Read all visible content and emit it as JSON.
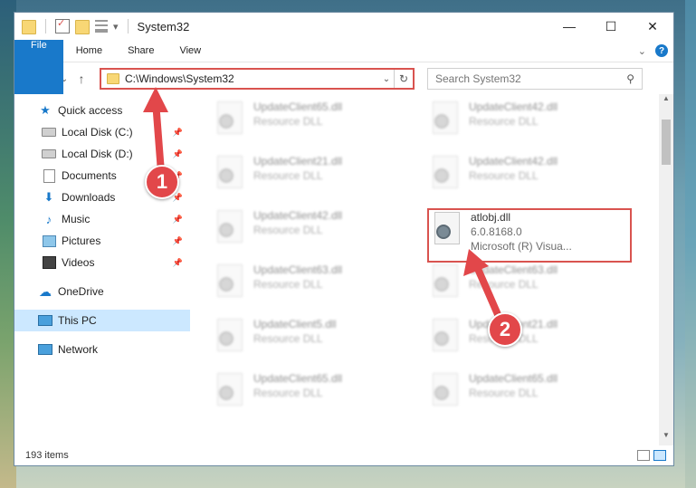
{
  "window": {
    "title": "System32",
    "controls": [
      "—",
      "☐",
      "✕"
    ]
  },
  "ribbon": {
    "tabs": [
      "File",
      "Home",
      "Share",
      "View"
    ]
  },
  "address": {
    "path": "C:\\Windows\\System32"
  },
  "search": {
    "placeholder": "Search System32"
  },
  "sidebar": {
    "items": [
      {
        "label": "Quick access",
        "icon": "star-icon"
      },
      {
        "label": "Local Disk (C:)",
        "icon": "disk-icon",
        "pinned": true
      },
      {
        "label": "Local Disk (D:)",
        "icon": "disk-icon",
        "pinned": true
      },
      {
        "label": "Documents",
        "icon": "documents-icon",
        "pinned": true
      },
      {
        "label": "Downloads",
        "icon": "download-icon",
        "pinned": true
      },
      {
        "label": "Music",
        "icon": "music-icon",
        "pinned": true
      },
      {
        "label": "Pictures",
        "icon": "pictures-icon",
        "pinned": true
      },
      {
        "label": "Videos",
        "icon": "videos-icon",
        "pinned": true
      },
      {
        "label": "OneDrive",
        "icon": "cloud-icon"
      },
      {
        "label": "This PC",
        "icon": "computer-icon",
        "selected": true
      },
      {
        "label": "Network",
        "icon": "network-icon"
      }
    ]
  },
  "files": [
    {
      "name": "UpdateClient65.dll",
      "sub": "Resource DLL"
    },
    {
      "name": "UpdateClient42.dll",
      "sub": "Resource DLL"
    },
    {
      "name": "UpdateClient21.dll",
      "sub": "Resource DLL"
    },
    {
      "name": "UpdateClient42.dll",
      "sub": "Resource DLL"
    },
    {
      "name": "UpdateClient42.dll",
      "sub": "Resource DLL"
    },
    {
      "name": "atlobj.dll",
      "version": "6.0.8168.0",
      "sub": "Microsoft (R) Visua..."
    },
    {
      "name": "UpdateClient63.dll",
      "sub": "Resource DLL"
    },
    {
      "name": "UpdateClient63.dll",
      "sub": "Resource DLL"
    },
    {
      "name": "UpdateClient5.dll",
      "sub": "Resource DLL"
    },
    {
      "name": "UpdateClient21.dll",
      "sub": "Resource DLL"
    },
    {
      "name": "UpdateClient65.dll",
      "sub": "Resource DLL"
    },
    {
      "name": "UpdateClient65.dll",
      "sub": "Resource DLL"
    }
  ],
  "status": {
    "count": "193 items"
  },
  "callouts": [
    "1",
    "2"
  ],
  "colors": {
    "accent": "#1979ca",
    "highlight": "#d9534f"
  }
}
